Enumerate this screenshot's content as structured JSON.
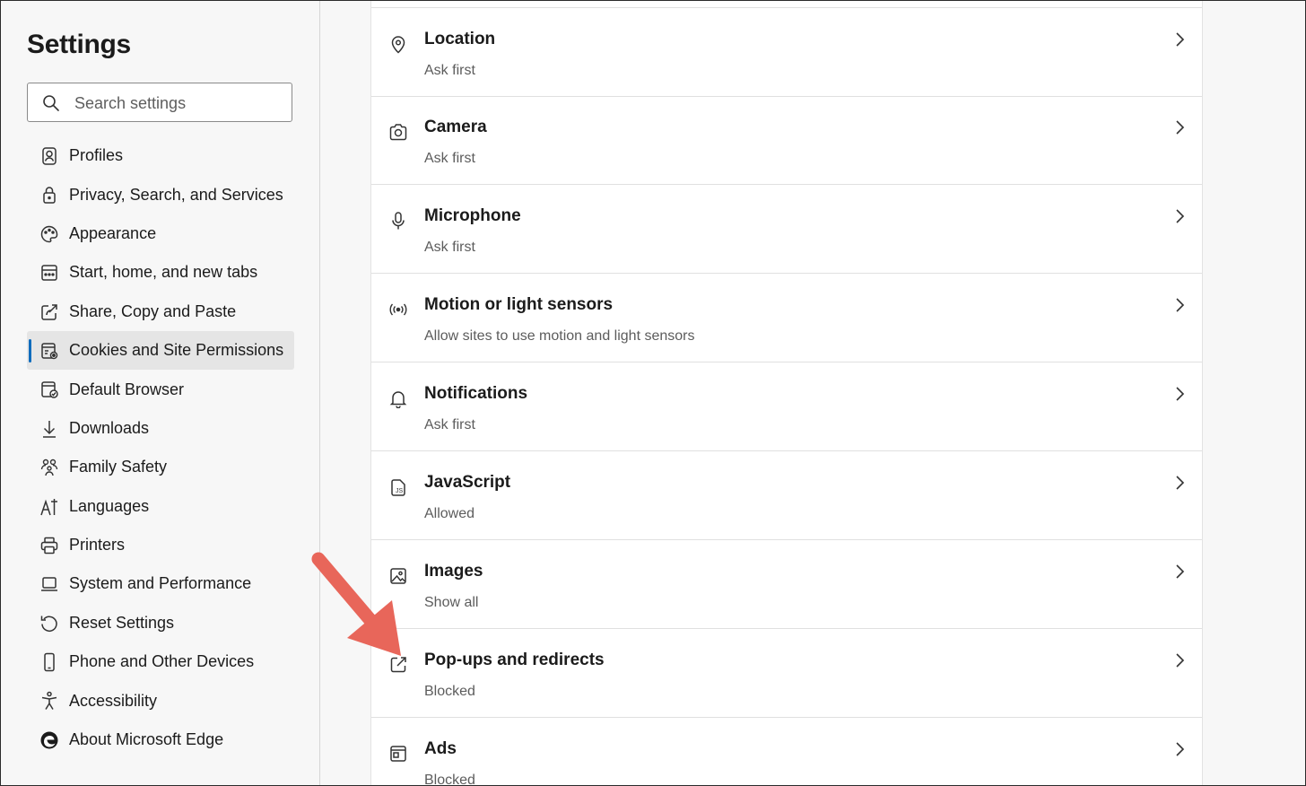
{
  "sidebar": {
    "title": "Settings",
    "search_placeholder": "Search settings",
    "items": [
      {
        "label": "Profiles",
        "icon": "profile-icon"
      },
      {
        "label": "Privacy, Search, and Services",
        "icon": "lock-icon"
      },
      {
        "label": "Appearance",
        "icon": "palette-icon"
      },
      {
        "label": "Start, home, and new tabs",
        "icon": "home-tabs-icon"
      },
      {
        "label": "Share, Copy and Paste",
        "icon": "share-icon"
      },
      {
        "label": "Cookies and Site Permissions",
        "icon": "cookies-permissions-icon",
        "active": true
      },
      {
        "label": "Default Browser",
        "icon": "default-browser-icon"
      },
      {
        "label": "Downloads",
        "icon": "download-icon"
      },
      {
        "label": "Family Safety",
        "icon": "family-icon"
      },
      {
        "label": "Languages",
        "icon": "languages-icon"
      },
      {
        "label": "Printers",
        "icon": "printer-icon"
      },
      {
        "label": "System and Performance",
        "icon": "laptop-icon"
      },
      {
        "label": "Reset Settings",
        "icon": "reset-icon"
      },
      {
        "label": "Phone and Other Devices",
        "icon": "phone-icon"
      },
      {
        "label": "Accessibility",
        "icon": "accessibility-icon"
      },
      {
        "label": "About Microsoft Edge",
        "icon": "edge-logo-icon"
      }
    ]
  },
  "permissions": [
    {
      "title": "Location",
      "subtitle": "Ask first",
      "icon": "location-icon"
    },
    {
      "title": "Camera",
      "subtitle": "Ask first",
      "icon": "camera-icon"
    },
    {
      "title": "Microphone",
      "subtitle": "Ask first",
      "icon": "microphone-icon"
    },
    {
      "title": "Motion or light sensors",
      "subtitle": "Allow sites to use motion and light sensors",
      "icon": "sensor-icon"
    },
    {
      "title": "Notifications",
      "subtitle": "Ask first",
      "icon": "bell-icon"
    },
    {
      "title": "JavaScript",
      "subtitle": "Allowed",
      "icon": "javascript-icon"
    },
    {
      "title": "Images",
      "subtitle": "Show all",
      "icon": "image-icon"
    },
    {
      "title": "Pop-ups and redirects",
      "subtitle": "Blocked",
      "icon": "popup-icon"
    },
    {
      "title": "Ads",
      "subtitle": "Blocked",
      "icon": "ads-icon"
    }
  ],
  "colors": {
    "accent": "#0f6cbd",
    "annotation_arrow": "#e8665a"
  }
}
